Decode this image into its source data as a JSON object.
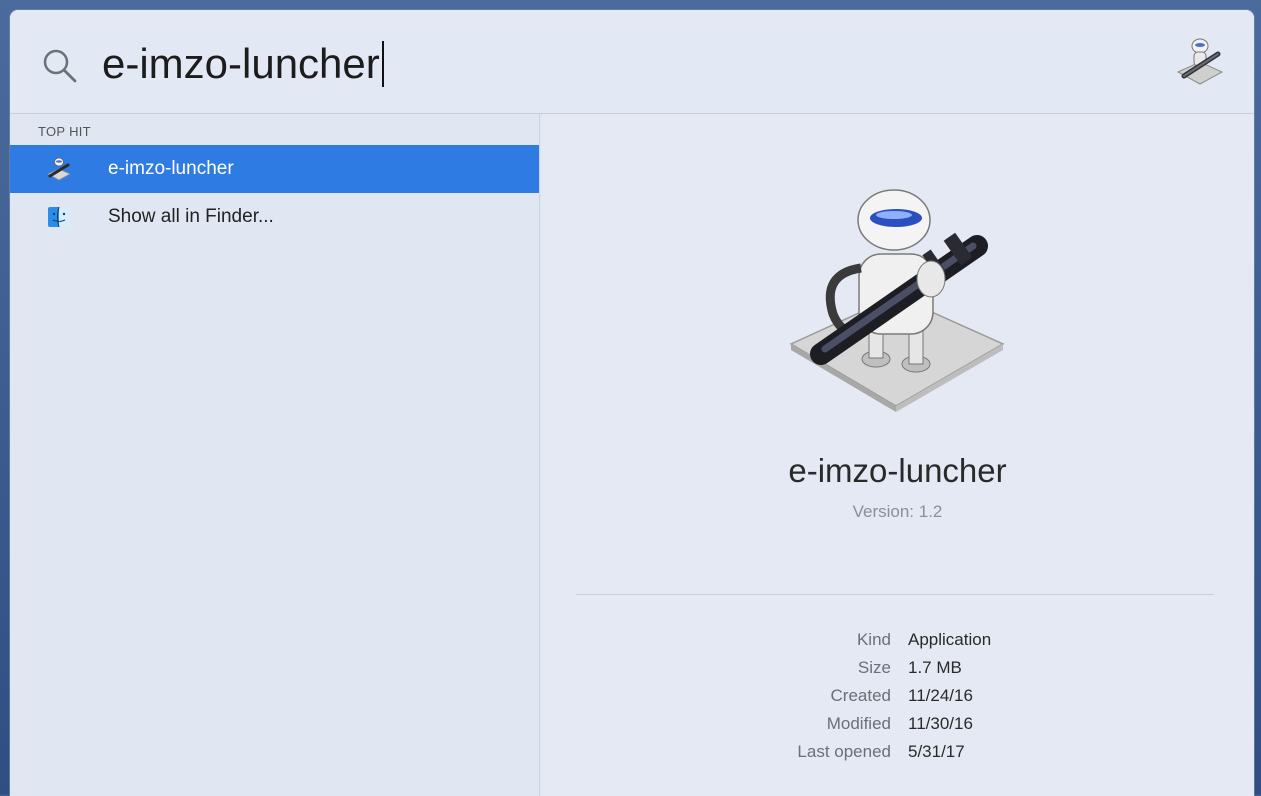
{
  "search": {
    "query": "e-imzo-luncher"
  },
  "results": {
    "section_header": "TOP HIT",
    "items": [
      {
        "label": "e-imzo-luncher",
        "icon": "automator-icon",
        "selected": true
      },
      {
        "label": "Show all in Finder...",
        "icon": "finder-icon",
        "selected": false
      }
    ]
  },
  "preview": {
    "icon": "automator-icon",
    "title": "e-imzo-luncher",
    "version": "Version: 1.2",
    "meta": [
      {
        "key": "Kind",
        "value": "Application"
      },
      {
        "key": "Size",
        "value": "1.7 MB"
      },
      {
        "key": "Created",
        "value": "11/24/16"
      },
      {
        "key": "Modified",
        "value": "11/30/16"
      },
      {
        "key": "Last opened",
        "value": "5/31/17"
      }
    ]
  },
  "colors": {
    "selection": "#2f7be4",
    "panel_background": "#e1e7f2"
  }
}
